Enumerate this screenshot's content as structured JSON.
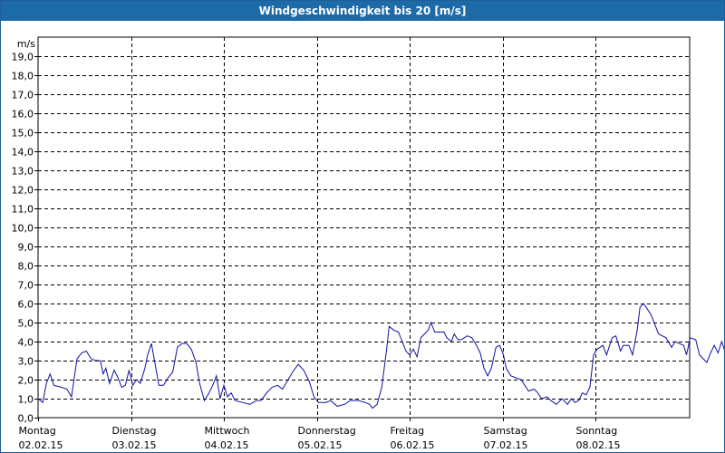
{
  "window": {
    "title": "Windgeschwindigkeit bis 20 [m/s]"
  },
  "colors": {
    "titlebar": "#1c6aa8",
    "line": "#1010a0",
    "grid": "#000000"
  },
  "chart_data": {
    "type": "line",
    "title": "Windgeschwindigkeit bis 20 [m/s]",
    "ylabel": "m/s",
    "ylim": [
      0,
      20
    ],
    "yticks": [
      0,
      1,
      2,
      3,
      4,
      5,
      6,
      7,
      8,
      9,
      10,
      11,
      12,
      13,
      14,
      15,
      16,
      17,
      18,
      19
    ],
    "xlim": [
      0,
      7
    ],
    "x_unit": "days",
    "grid": true,
    "days": [
      {
        "name": "Montag",
        "date": "02.02.15"
      },
      {
        "name": "Dienstag",
        "date": "03.02.15"
      },
      {
        "name": "Mittwoch",
        "date": "04.02.15"
      },
      {
        "name": "Donnerstag",
        "date": "05.02.15"
      },
      {
        "name": "Freitag",
        "date": "06.02.15"
      },
      {
        "name": "Samstag",
        "date": "07.02.15"
      },
      {
        "name": "Sonntag",
        "date": "08.02.15"
      }
    ],
    "series": [
      {
        "values": [
          [
            0.0,
            1.0
          ],
          [
            0.05,
            0.8
          ],
          [
            0.09,
            1.8
          ],
          [
            0.13,
            2.3
          ],
          [
            0.17,
            1.7
          ],
          [
            0.25,
            1.6
          ],
          [
            0.31,
            1.5
          ],
          [
            0.36,
            1.1
          ],
          [
            0.42,
            3.1
          ],
          [
            0.47,
            3.4
          ],
          [
            0.52,
            3.5
          ],
          [
            0.57,
            3.1
          ],
          [
            0.62,
            3.0
          ],
          [
            0.67,
            3.0
          ],
          [
            0.7,
            2.3
          ],
          [
            0.73,
            2.6
          ],
          [
            0.77,
            1.8
          ],
          [
            0.82,
            2.5
          ],
          [
            0.86,
            2.1
          ],
          [
            0.9,
            1.6
          ],
          [
            0.94,
            1.7
          ],
          [
            0.98,
            2.5
          ],
          [
            1.02,
            1.7
          ],
          [
            1.06,
            2.0
          ],
          [
            1.1,
            1.8
          ],
          [
            1.15,
            2.6
          ],
          [
            1.18,
            3.3
          ],
          [
            1.22,
            3.9
          ],
          [
            1.26,
            2.8
          ],
          [
            1.3,
            1.7
          ],
          [
            1.35,
            1.7
          ],
          [
            1.4,
            2.1
          ],
          [
            1.45,
            2.4
          ],
          [
            1.5,
            3.7
          ],
          [
            1.55,
            3.9
          ],
          [
            1.6,
            3.9
          ],
          [
            1.65,
            3.6
          ],
          [
            1.7,
            2.9
          ],
          [
            1.74,
            1.8
          ],
          [
            1.79,
            0.9
          ],
          [
            1.84,
            1.3
          ],
          [
            1.88,
            1.7
          ],
          [
            1.92,
            2.2
          ],
          [
            1.96,
            1.0
          ],
          [
            2.0,
            1.7
          ],
          [
            2.04,
            1.1
          ],
          [
            2.08,
            1.3
          ],
          [
            2.12,
            0.9
          ],
          [
            2.2,
            0.8
          ],
          [
            2.28,
            0.7
          ],
          [
            2.35,
            0.9
          ],
          [
            2.4,
            0.9
          ],
          [
            2.46,
            1.3
          ],
          [
            2.52,
            1.6
          ],
          [
            2.58,
            1.7
          ],
          [
            2.63,
            1.5
          ],
          [
            2.68,
            1.9
          ],
          [
            2.74,
            2.4
          ],
          [
            2.8,
            2.8
          ],
          [
            2.86,
            2.5
          ],
          [
            2.92,
            1.9
          ],
          [
            2.97,
            1.1
          ],
          [
            3.02,
            0.8
          ],
          [
            3.1,
            0.8
          ],
          [
            3.15,
            0.9
          ],
          [
            3.22,
            0.6
          ],
          [
            3.3,
            0.7
          ],
          [
            3.36,
            0.9
          ],
          [
            3.45,
            0.9
          ],
          [
            3.52,
            0.8
          ],
          [
            3.57,
            0.7
          ],
          [
            3.6,
            0.5
          ],
          [
            3.65,
            0.7
          ],
          [
            3.7,
            1.6
          ],
          [
            3.75,
            3.5
          ],
          [
            3.78,
            4.8
          ],
          [
            3.83,
            4.6
          ],
          [
            3.88,
            4.5
          ],
          [
            3.92,
            4.0
          ],
          [
            3.96,
            3.5
          ],
          [
            4.0,
            3.3
          ],
          [
            4.04,
            3.6
          ],
          [
            4.08,
            3.2
          ],
          [
            4.12,
            4.2
          ],
          [
            4.16,
            4.4
          ],
          [
            4.2,
            4.6
          ],
          [
            4.23,
            5.0
          ],
          [
            4.27,
            4.5
          ],
          [
            4.32,
            4.5
          ],
          [
            4.37,
            4.5
          ],
          [
            4.4,
            4.2
          ],
          [
            4.45,
            4.0
          ],
          [
            4.48,
            4.4
          ],
          [
            4.52,
            4.1
          ],
          [
            4.56,
            4.1
          ],
          [
            4.62,
            4.3
          ],
          [
            4.67,
            4.2
          ],
          [
            4.72,
            3.8
          ],
          [
            4.76,
            3.4
          ],
          [
            4.8,
            2.6
          ],
          [
            4.84,
            2.2
          ],
          [
            4.88,
            2.6
          ],
          [
            4.93,
            3.7
          ],
          [
            4.97,
            3.8
          ],
          [
            5.01,
            3.3
          ],
          [
            5.04,
            2.6
          ],
          [
            5.09,
            2.2
          ],
          [
            5.14,
            2.1
          ],
          [
            5.2,
            2.0
          ],
          [
            5.24,
            1.7
          ],
          [
            5.28,
            1.4
          ],
          [
            5.34,
            1.5
          ],
          [
            5.38,
            1.3
          ],
          [
            5.42,
            1.0
          ],
          [
            5.48,
            1.1
          ],
          [
            5.52,
            0.9
          ],
          [
            5.58,
            0.7
          ],
          [
            5.64,
            1.0
          ],
          [
            5.7,
            0.7
          ],
          [
            5.74,
            1.0
          ],
          [
            5.78,
            0.8
          ],
          [
            5.82,
            0.9
          ],
          [
            5.86,
            1.3
          ],
          [
            5.9,
            1.2
          ],
          [
            5.94,
            1.6
          ],
          [
            5.98,
            3.3
          ],
          [
            6.02,
            3.6
          ],
          [
            6.08,
            3.8
          ],
          [
            6.12,
            3.3
          ],
          [
            6.18,
            4.2
          ],
          [
            6.22,
            4.3
          ],
          [
            6.27,
            3.5
          ],
          [
            6.3,
            3.8
          ],
          [
            6.36,
            3.8
          ],
          [
            6.4,
            3.3
          ],
          [
            6.45,
            4.6
          ],
          [
            6.48,
            5.8
          ],
          [
            6.52,
            6.0
          ],
          [
            6.56,
            5.7
          ],
          [
            6.6,
            5.4
          ],
          [
            6.64,
            4.9
          ],
          [
            6.68,
            4.4
          ],
          [
            6.72,
            4.3
          ],
          [
            6.76,
            4.2
          ],
          [
            6.82,
            3.7
          ],
          [
            6.86,
            4.0
          ],
          [
            6.9,
            3.9
          ],
          [
            6.95,
            3.8
          ],
          [
            6.98,
            3.3
          ],
          [
            7.02,
            4.2
          ],
          [
            7.08,
            4.1
          ],
          [
            7.12,
            3.3
          ],
          [
            7.16,
            3.1
          ],
          [
            7.2,
            2.9
          ],
          [
            7.24,
            3.4
          ],
          [
            7.28,
            3.8
          ],
          [
            7.32,
            3.4
          ],
          [
            7.36,
            4.0
          ],
          [
            7.4,
            3.4
          ]
        ]
      }
    ]
  }
}
